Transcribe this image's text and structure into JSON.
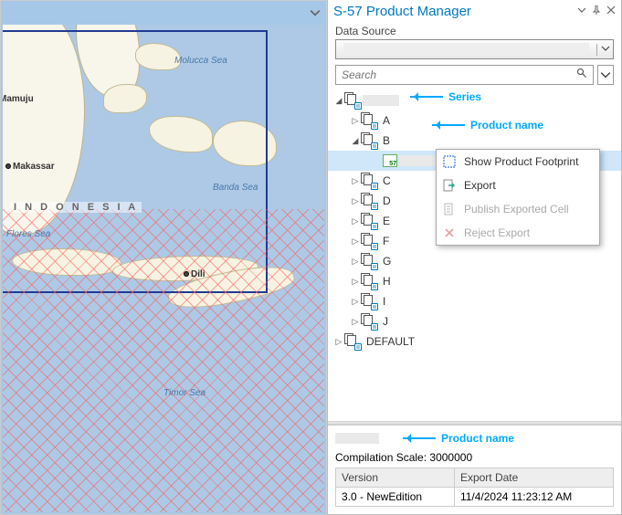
{
  "panel": {
    "title": "S-57 Product Manager",
    "data_source_label": "Data Source",
    "search_placeholder": "Search"
  },
  "tree": {
    "series_redacted": true,
    "items": [
      {
        "label": "A",
        "expanded": false
      },
      {
        "label": "B",
        "expanded": true,
        "selected_child_redacted": true
      },
      {
        "label": "C",
        "expanded": false
      },
      {
        "label": "D",
        "expanded": false
      },
      {
        "label": "E",
        "expanded": false
      },
      {
        "label": "F",
        "expanded": false
      },
      {
        "label": "G",
        "expanded": false
      },
      {
        "label": "H",
        "expanded": false
      },
      {
        "label": "I",
        "expanded": false
      },
      {
        "label": "J",
        "expanded": false
      }
    ],
    "default_label": "DEFAULT"
  },
  "context_menu": {
    "items": [
      {
        "label": "Show Product Footprint",
        "enabled": true,
        "icon": "footprint"
      },
      {
        "label": "Export",
        "enabled": true,
        "icon": "export"
      },
      {
        "label": "Publish Exported Cell",
        "enabled": false,
        "icon": "publish"
      },
      {
        "label": "Reject Export",
        "enabled": false,
        "icon": "reject"
      }
    ]
  },
  "annotations": {
    "series": "Series",
    "product_name": "Product name"
  },
  "details": {
    "compilation_scale_label": "Compilation Scale:",
    "compilation_scale_value": "3000000",
    "columns": {
      "version": "Version",
      "export_date": "Export Date"
    },
    "row": {
      "version": "3.0 - NewEdition",
      "export_date": "11/4/2024 11:23:12 AM"
    }
  },
  "map": {
    "labels": {
      "country": "I N D O N E S I A",
      "molucca": "Molucca\nSea",
      "banda": "Banda\nSea",
      "flores": "Flores\nSea",
      "timor": "Timor Sea",
      "makassar": "Makassar",
      "mamuju": "Mamuju",
      "dili": "Dili"
    }
  }
}
